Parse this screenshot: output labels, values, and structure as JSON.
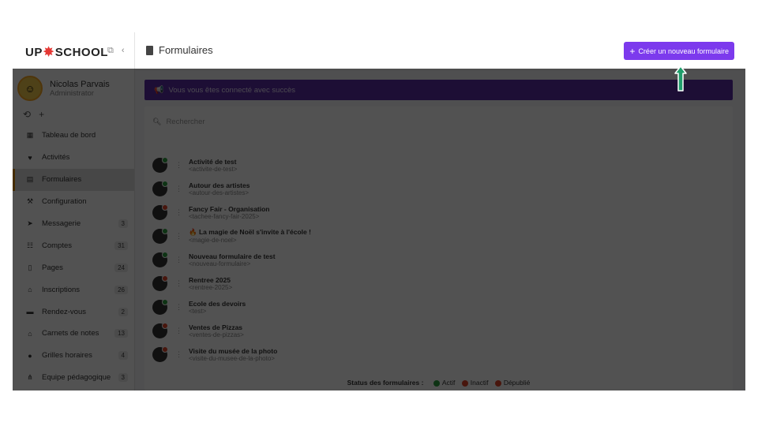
{
  "app": {
    "logo_text_a": "UP",
    "logo_text_b": "SCHOOL",
    "user": {
      "name": "Nicolas Parvais",
      "role": "Administrator"
    }
  },
  "nav": [
    {
      "label": "Tableau de bord",
      "icon": "dashboard-icon",
      "glyph": "▦",
      "badge": ""
    },
    {
      "label": "Activités",
      "icon": "heart-icon",
      "glyph": "♥",
      "badge": ""
    },
    {
      "label": "Formulaires",
      "icon": "form-icon",
      "glyph": "▤",
      "badge": "",
      "active": true
    },
    {
      "label": "Configuration",
      "icon": "wrench-icon",
      "glyph": "⚒",
      "badge": ""
    },
    {
      "label": "Messagerie",
      "icon": "paper-plane-icon",
      "glyph": "➤",
      "badge": "3"
    },
    {
      "label": "Comptes",
      "icon": "users-icon",
      "glyph": "☷",
      "badge": "31"
    },
    {
      "label": "Pages",
      "icon": "file-icon",
      "glyph": "▯",
      "badge": "24"
    },
    {
      "label": "Inscriptions",
      "icon": "institution-icon",
      "glyph": "⌂",
      "badge": "26"
    },
    {
      "label": "Rendez-vous",
      "icon": "calendar-icon",
      "glyph": "▬",
      "badge": "2"
    },
    {
      "label": "Carnets de notes",
      "icon": "institution-icon",
      "glyph": "⌂",
      "badge": "13"
    },
    {
      "label": "Grilles horaires",
      "icon": "clock-icon",
      "glyph": "●",
      "badge": "4"
    },
    {
      "label": "Equipe pédagogique",
      "icon": "sitemap-icon",
      "glyph": "⋔",
      "badge": "3"
    }
  ],
  "header": {
    "title": "Formulaires",
    "create_button": "Créer un nouveau formulaire"
  },
  "alert": {
    "text": "Vous vous êtes connecté avec succès"
  },
  "search": {
    "placeholder": "Rechercher"
  },
  "forms": [
    {
      "title": "Activité de test",
      "slug": "<activite-de-test>",
      "status": "active"
    },
    {
      "title": "Autour des artistes",
      "slug": "<autour-des-artistes>",
      "status": "active"
    },
    {
      "title": "Fancy Fair - Organisation",
      "slug": "<tachee-fancy-fair-2025>",
      "status": "inactive"
    },
    {
      "title": "🔥 La magie de Noël s'invite à l'école !",
      "slug": "<magie-de-noel>",
      "status": "active"
    },
    {
      "title": "Nouveau formulaire de test",
      "slug": "<nouveau-formulaire>",
      "status": "active"
    },
    {
      "title": "Rentree 2025",
      "slug": "<rentree-2025>",
      "status": "inactive"
    },
    {
      "title": "Ecole des devoirs",
      "slug": "<test>",
      "status": "active"
    },
    {
      "title": "Ventes de Pizzas",
      "slug": "<ventes-de-pizzas>",
      "status": "inactive"
    },
    {
      "title": "Visite du musée de la photo",
      "slug": "<visite-du-musee-de-la-photo>",
      "status": "inactive"
    }
  ],
  "legend": {
    "label": "Status des formulaires :",
    "active": "Actif",
    "inactive": "Inactif",
    "unpublished": "Dépublié"
  },
  "colors": {
    "accent": "#7c3aed",
    "alert_bg": "#5b2ea6",
    "status_active": "#2e9e3e",
    "status_inactive": "#e0452b",
    "status_unpublished": "#e0452b",
    "arrow": "#1f9d6b"
  }
}
